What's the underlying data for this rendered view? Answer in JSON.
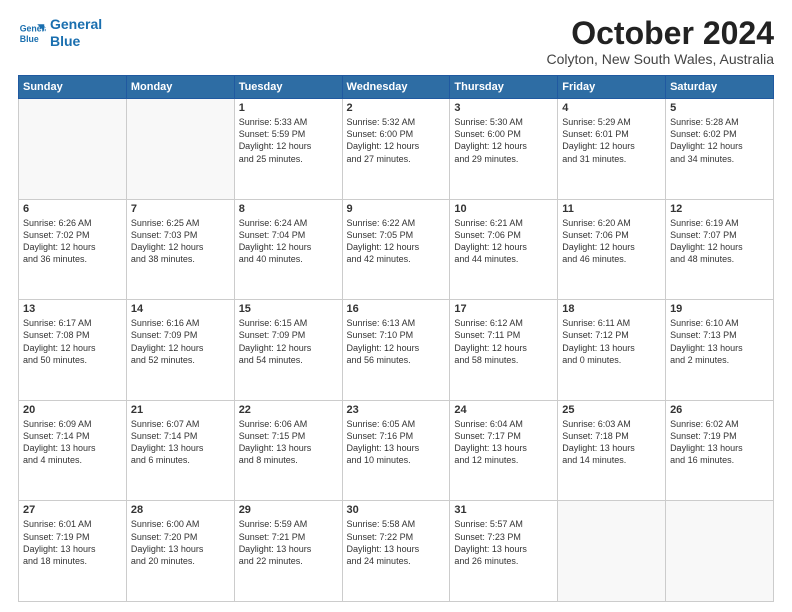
{
  "logo": {
    "line1": "General",
    "line2": "Blue"
  },
  "title": "October 2024",
  "location": "Colyton, New South Wales, Australia",
  "days_of_week": [
    "Sunday",
    "Monday",
    "Tuesday",
    "Wednesday",
    "Thursday",
    "Friday",
    "Saturday"
  ],
  "weeks": [
    [
      {
        "day": "",
        "info": ""
      },
      {
        "day": "",
        "info": ""
      },
      {
        "day": "1",
        "info": "Sunrise: 5:33 AM\nSunset: 5:59 PM\nDaylight: 12 hours\nand 25 minutes."
      },
      {
        "day": "2",
        "info": "Sunrise: 5:32 AM\nSunset: 6:00 PM\nDaylight: 12 hours\nand 27 minutes."
      },
      {
        "day": "3",
        "info": "Sunrise: 5:30 AM\nSunset: 6:00 PM\nDaylight: 12 hours\nand 29 minutes."
      },
      {
        "day": "4",
        "info": "Sunrise: 5:29 AM\nSunset: 6:01 PM\nDaylight: 12 hours\nand 31 minutes."
      },
      {
        "day": "5",
        "info": "Sunrise: 5:28 AM\nSunset: 6:02 PM\nDaylight: 12 hours\nand 34 minutes."
      }
    ],
    [
      {
        "day": "6",
        "info": "Sunrise: 6:26 AM\nSunset: 7:02 PM\nDaylight: 12 hours\nand 36 minutes."
      },
      {
        "day": "7",
        "info": "Sunrise: 6:25 AM\nSunset: 7:03 PM\nDaylight: 12 hours\nand 38 minutes."
      },
      {
        "day": "8",
        "info": "Sunrise: 6:24 AM\nSunset: 7:04 PM\nDaylight: 12 hours\nand 40 minutes."
      },
      {
        "day": "9",
        "info": "Sunrise: 6:22 AM\nSunset: 7:05 PM\nDaylight: 12 hours\nand 42 minutes."
      },
      {
        "day": "10",
        "info": "Sunrise: 6:21 AM\nSunset: 7:06 PM\nDaylight: 12 hours\nand 44 minutes."
      },
      {
        "day": "11",
        "info": "Sunrise: 6:20 AM\nSunset: 7:06 PM\nDaylight: 12 hours\nand 46 minutes."
      },
      {
        "day": "12",
        "info": "Sunrise: 6:19 AM\nSunset: 7:07 PM\nDaylight: 12 hours\nand 48 minutes."
      }
    ],
    [
      {
        "day": "13",
        "info": "Sunrise: 6:17 AM\nSunset: 7:08 PM\nDaylight: 12 hours\nand 50 minutes."
      },
      {
        "day": "14",
        "info": "Sunrise: 6:16 AM\nSunset: 7:09 PM\nDaylight: 12 hours\nand 52 minutes."
      },
      {
        "day": "15",
        "info": "Sunrise: 6:15 AM\nSunset: 7:09 PM\nDaylight: 12 hours\nand 54 minutes."
      },
      {
        "day": "16",
        "info": "Sunrise: 6:13 AM\nSunset: 7:10 PM\nDaylight: 12 hours\nand 56 minutes."
      },
      {
        "day": "17",
        "info": "Sunrise: 6:12 AM\nSunset: 7:11 PM\nDaylight: 12 hours\nand 58 minutes."
      },
      {
        "day": "18",
        "info": "Sunrise: 6:11 AM\nSunset: 7:12 PM\nDaylight: 13 hours\nand 0 minutes."
      },
      {
        "day": "19",
        "info": "Sunrise: 6:10 AM\nSunset: 7:13 PM\nDaylight: 13 hours\nand 2 minutes."
      }
    ],
    [
      {
        "day": "20",
        "info": "Sunrise: 6:09 AM\nSunset: 7:14 PM\nDaylight: 13 hours\nand 4 minutes."
      },
      {
        "day": "21",
        "info": "Sunrise: 6:07 AM\nSunset: 7:14 PM\nDaylight: 13 hours\nand 6 minutes."
      },
      {
        "day": "22",
        "info": "Sunrise: 6:06 AM\nSunset: 7:15 PM\nDaylight: 13 hours\nand 8 minutes."
      },
      {
        "day": "23",
        "info": "Sunrise: 6:05 AM\nSunset: 7:16 PM\nDaylight: 13 hours\nand 10 minutes."
      },
      {
        "day": "24",
        "info": "Sunrise: 6:04 AM\nSunset: 7:17 PM\nDaylight: 13 hours\nand 12 minutes."
      },
      {
        "day": "25",
        "info": "Sunrise: 6:03 AM\nSunset: 7:18 PM\nDaylight: 13 hours\nand 14 minutes."
      },
      {
        "day": "26",
        "info": "Sunrise: 6:02 AM\nSunset: 7:19 PM\nDaylight: 13 hours\nand 16 minutes."
      }
    ],
    [
      {
        "day": "27",
        "info": "Sunrise: 6:01 AM\nSunset: 7:19 PM\nDaylight: 13 hours\nand 18 minutes."
      },
      {
        "day": "28",
        "info": "Sunrise: 6:00 AM\nSunset: 7:20 PM\nDaylight: 13 hours\nand 20 minutes."
      },
      {
        "day": "29",
        "info": "Sunrise: 5:59 AM\nSunset: 7:21 PM\nDaylight: 13 hours\nand 22 minutes."
      },
      {
        "day": "30",
        "info": "Sunrise: 5:58 AM\nSunset: 7:22 PM\nDaylight: 13 hours\nand 24 minutes."
      },
      {
        "day": "31",
        "info": "Sunrise: 5:57 AM\nSunset: 7:23 PM\nDaylight: 13 hours\nand 26 minutes."
      },
      {
        "day": "",
        "info": ""
      },
      {
        "day": "",
        "info": ""
      }
    ]
  ]
}
